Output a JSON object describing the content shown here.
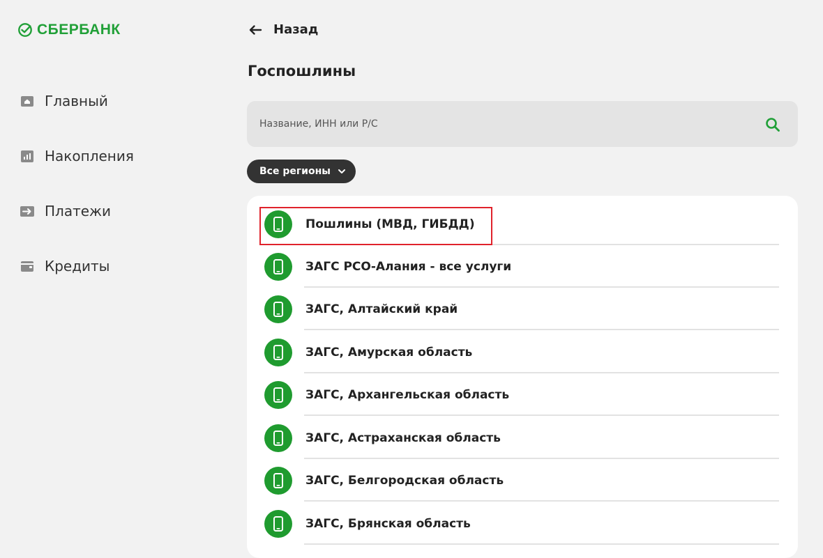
{
  "brand": {
    "name": "СБЕРБАНК",
    "color": "#21a038"
  },
  "sidebar": {
    "items": [
      {
        "label": "Главный",
        "icon": "home-icon"
      },
      {
        "label": "Накопления",
        "icon": "chart-icon"
      },
      {
        "label": "Платежи",
        "icon": "payment-arrow-icon"
      },
      {
        "label": "Кредиты",
        "icon": "wallet-icon"
      }
    ]
  },
  "header": {
    "back_label": "Назад",
    "title": "Госпошлины"
  },
  "search": {
    "placeholder": "Название, ИНН или Р/С",
    "value": ""
  },
  "filter": {
    "region_label": "Все регионы"
  },
  "list": {
    "items": [
      {
        "label": "Пошлины (МВД, ГИБДД)",
        "icon": "phone-icon",
        "highlighted": true
      },
      {
        "label": "ЗАГС РСО-Алания - все услуги",
        "icon": "phone-icon"
      },
      {
        "label": "ЗАГС, Алтайский край",
        "icon": "phone-icon"
      },
      {
        "label": "ЗАГС, Амурская область",
        "icon": "phone-icon"
      },
      {
        "label": "ЗАГС, Архангельская область",
        "icon": "phone-icon"
      },
      {
        "label": "ЗАГС, Астраханская область",
        "icon": "phone-icon"
      },
      {
        "label": "ЗАГС, Белгородская область",
        "icon": "phone-icon"
      },
      {
        "label": "ЗАГС, Брянская область",
        "icon": "phone-icon"
      }
    ]
  },
  "colors": {
    "accent": "#21a038",
    "item_icon_bg": "#1f9b2f",
    "highlight_border": "#e0222b",
    "chip_bg": "#333333"
  }
}
